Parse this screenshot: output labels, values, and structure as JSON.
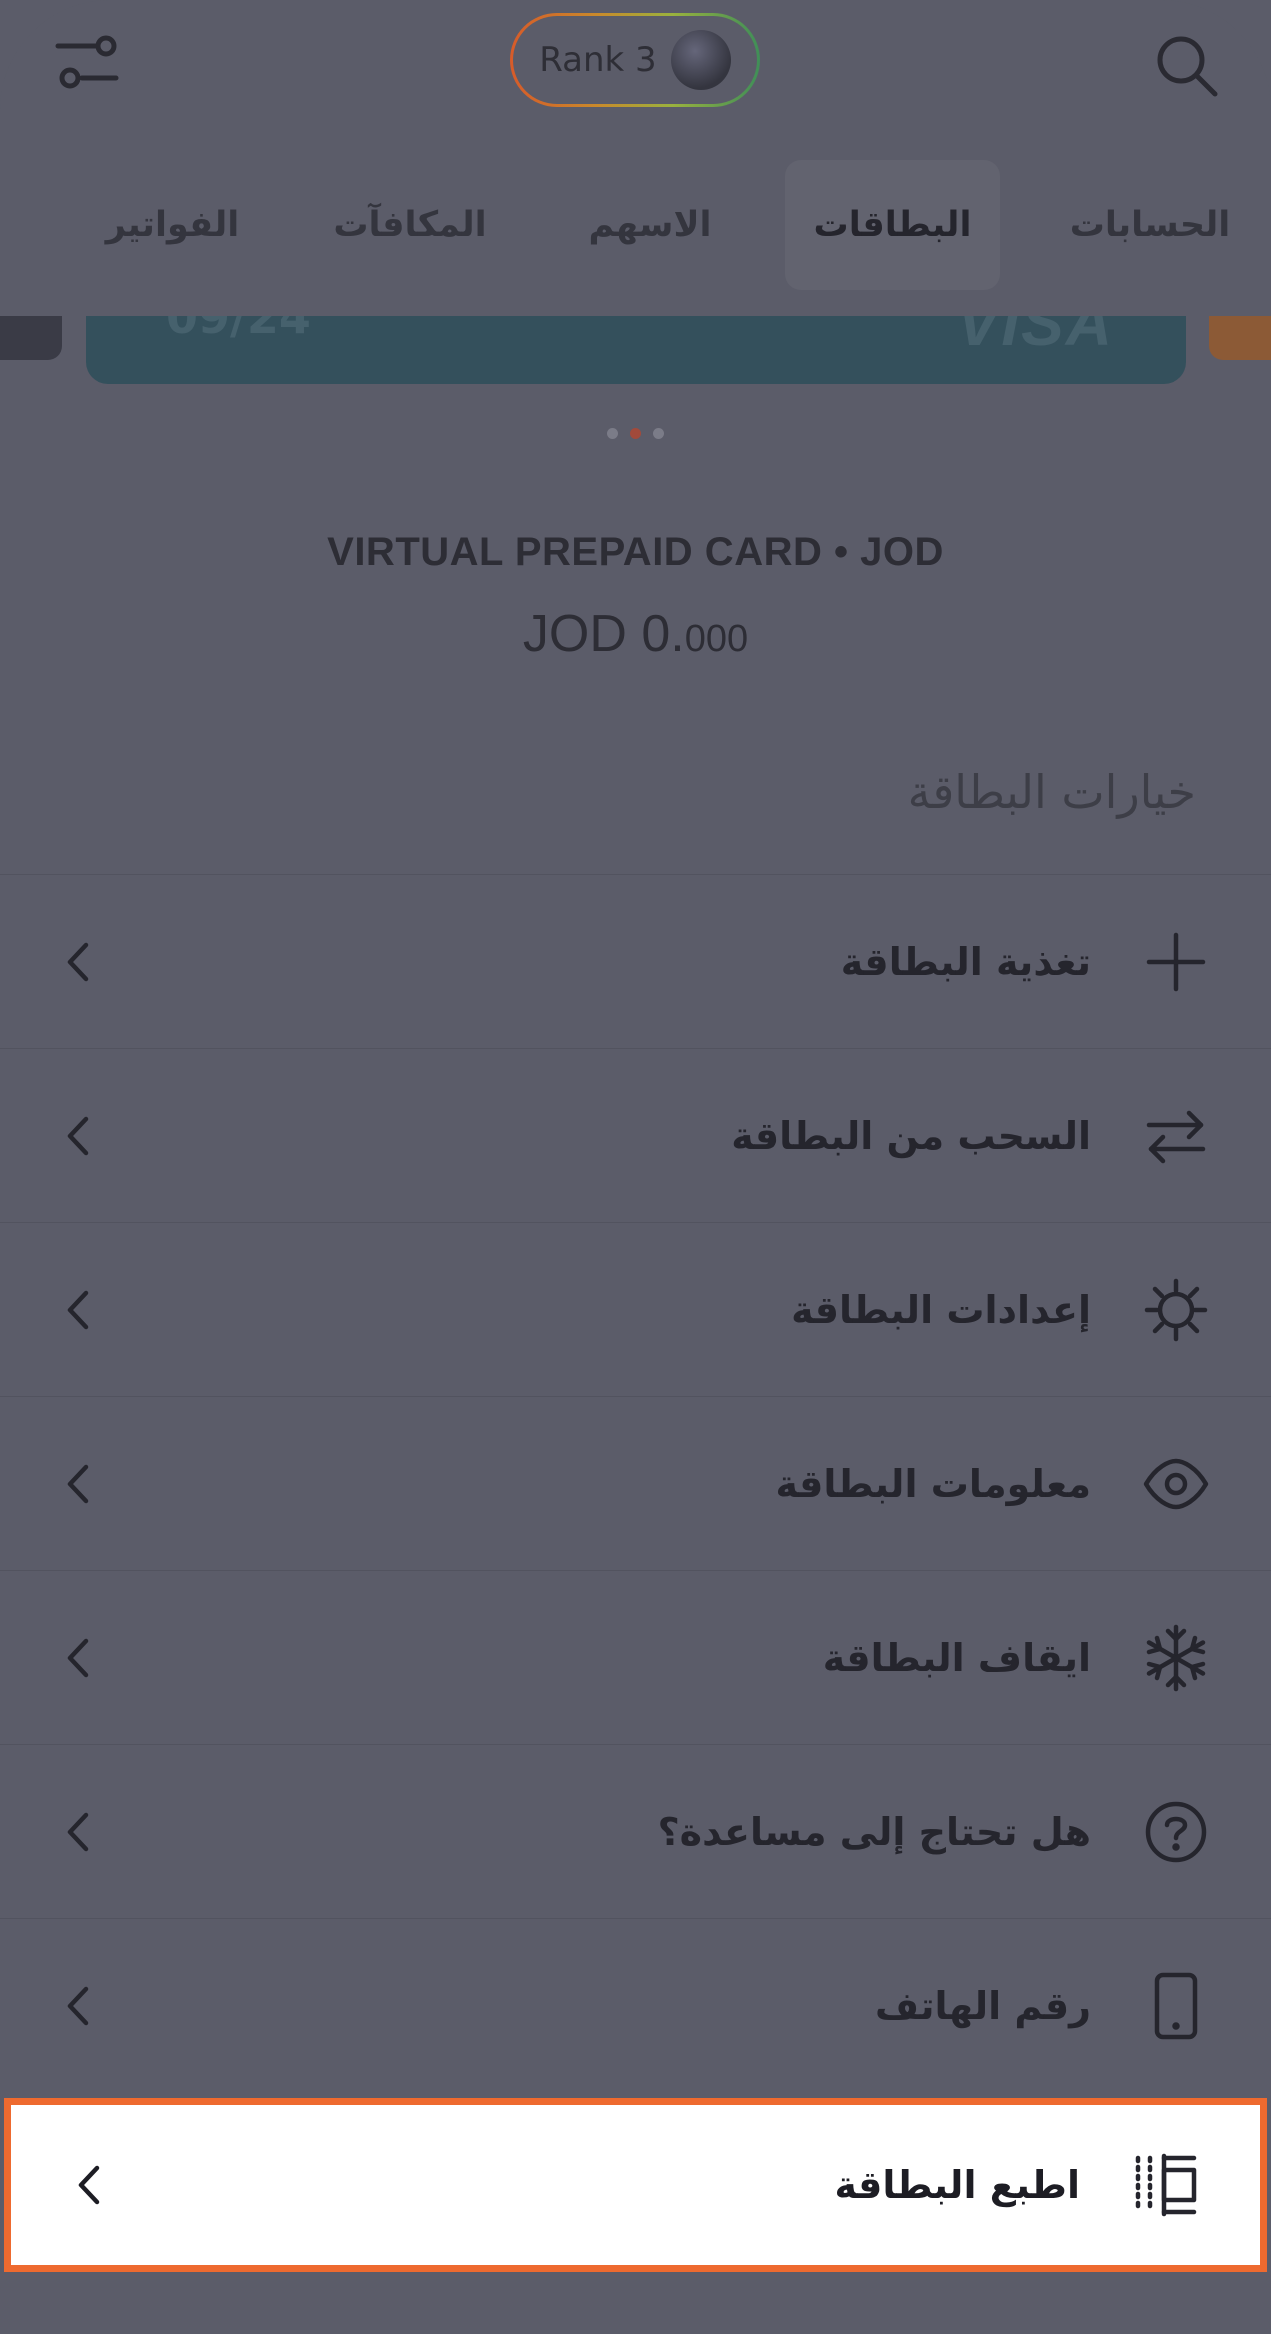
{
  "header": {
    "rank_label": "Rank 3",
    "icons": {
      "filter": "filter-sliders-icon",
      "search": "search-icon"
    }
  },
  "tabs": [
    {
      "label": "الحسابات",
      "active": false
    },
    {
      "label": "البطاقات",
      "active": true
    },
    {
      "label": "الاسهم",
      "active": false
    },
    {
      "label": "المكافآت",
      "active": false
    },
    {
      "label": "الفواتير",
      "active": false
    }
  ],
  "card": {
    "brand": "VISA",
    "expiry_partial": "09/24",
    "type_line": "VIRTUAL PREPAID CARD  •  JOD",
    "balance_main": "JOD 0.",
    "balance_decimals": "000",
    "carousel": {
      "count": 3,
      "active_index": 1
    }
  },
  "section_title": "خيارات البطاقة",
  "options": [
    {
      "label": "تغذية البطاقة",
      "icon": "plus-icon"
    },
    {
      "label": "السحب من البطاقة",
      "icon": "transfer-arrows-icon"
    },
    {
      "label": "إعدادات البطاقة",
      "icon": "settings-gear-icon"
    },
    {
      "label": "معلومات البطاقة",
      "icon": "eye-icon"
    },
    {
      "label": "ايقاف البطاقة",
      "icon": "snowflake-icon"
    },
    {
      "label": "هل تحتاج إلى مساعدة؟",
      "icon": "help-question-icon"
    },
    {
      "label": "رقم الهاتف",
      "icon": "mobile-phone-icon"
    },
    {
      "label": "اطبع البطاقة",
      "icon": "print-card-icon",
      "highlighted": true
    }
  ],
  "colors": {
    "overlay": "#5b5c69",
    "highlight_border": "#ee6a2f",
    "card_color": "#34505c"
  }
}
